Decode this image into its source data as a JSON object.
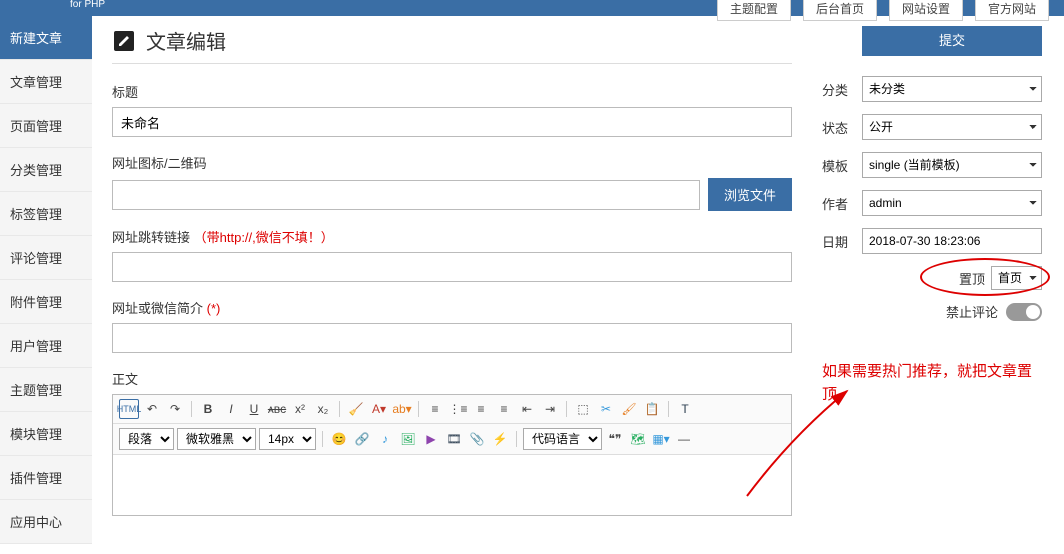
{
  "topbar": {
    "subtext": "for PHP"
  },
  "topnav": [
    "主题配置",
    "后台首页",
    "网站设置",
    "官方网站"
  ],
  "sidebar": {
    "items": [
      "新建文章",
      "文章管理",
      "页面管理",
      "分类管理",
      "标签管理",
      "评论管理",
      "附件管理",
      "用户管理",
      "主题管理",
      "模块管理",
      "插件管理",
      "应用中心"
    ],
    "active_index": 0
  },
  "page": {
    "title": "文章编辑"
  },
  "form": {
    "title_label": "标题",
    "title_value": "未命名",
    "url_icon_label": "网址图标/二维码",
    "browse_btn": "浏览文件",
    "redirect_label": "网址跳转链接",
    "redirect_note": "（带http://,微信不填！）",
    "intro_label": "网址或微信简介",
    "intro_req": "(*)",
    "body_label": "正文"
  },
  "side": {
    "submit": "提交",
    "category_label": "分类",
    "category_value": "未分类",
    "status_label": "状态",
    "status_value": "公开",
    "template_label": "模板",
    "template_value": "single (当前模板)",
    "author_label": "作者",
    "author_value": "admin",
    "date_label": "日期",
    "date_value": "2018-07-30 18:23:06",
    "pin_label": "置顶",
    "pin_value": "首页",
    "comment_disable_label": "禁止评论"
  },
  "annotation": "如果需要热门推荐，就把文章置顶",
  "editor": {
    "para_select": "段落",
    "font_select": "微软雅黑",
    "size_select": "14px",
    "code_select": "代码语言"
  }
}
